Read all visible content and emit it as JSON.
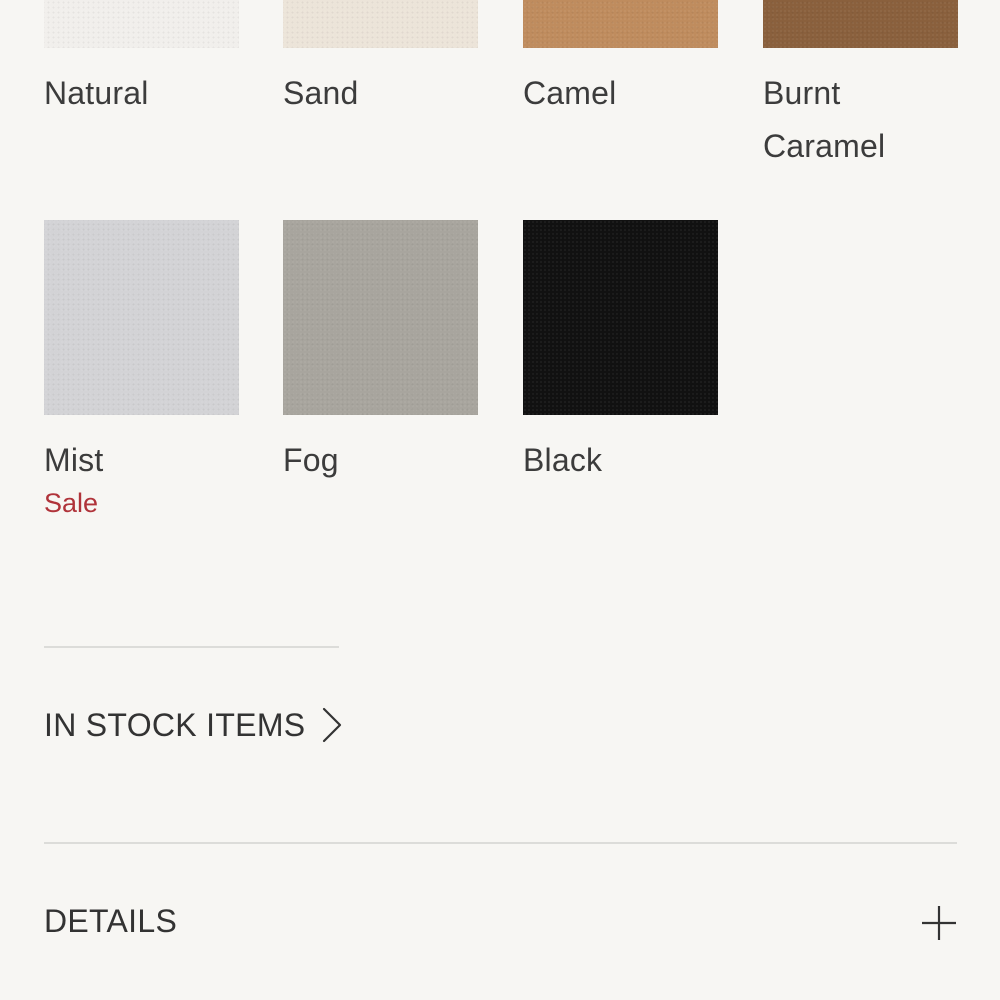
{
  "swatches": [
    {
      "name": "Natural",
      "color": "#f1efec"
    },
    {
      "name": "Sand",
      "color": "#ece4d9"
    },
    {
      "name": "Camel",
      "color": "#bf8c5e"
    },
    {
      "name": "Burnt Caramel",
      "line1": "Burnt",
      "line2": "Caramel",
      "color": "#8a603d"
    },
    {
      "name": "Mist",
      "color": "#d3d3d6",
      "badge": "Sale",
      "badge_color": "#b0333a"
    },
    {
      "name": "Fog",
      "color": "#a8a59e"
    },
    {
      "name": "Black",
      "color": "#111111"
    }
  ],
  "in_stock": {
    "label": "IN STOCK ITEMS",
    "icon": "chevron-right-icon"
  },
  "details": {
    "label": "DETAILS",
    "icon": "plus-icon"
  }
}
